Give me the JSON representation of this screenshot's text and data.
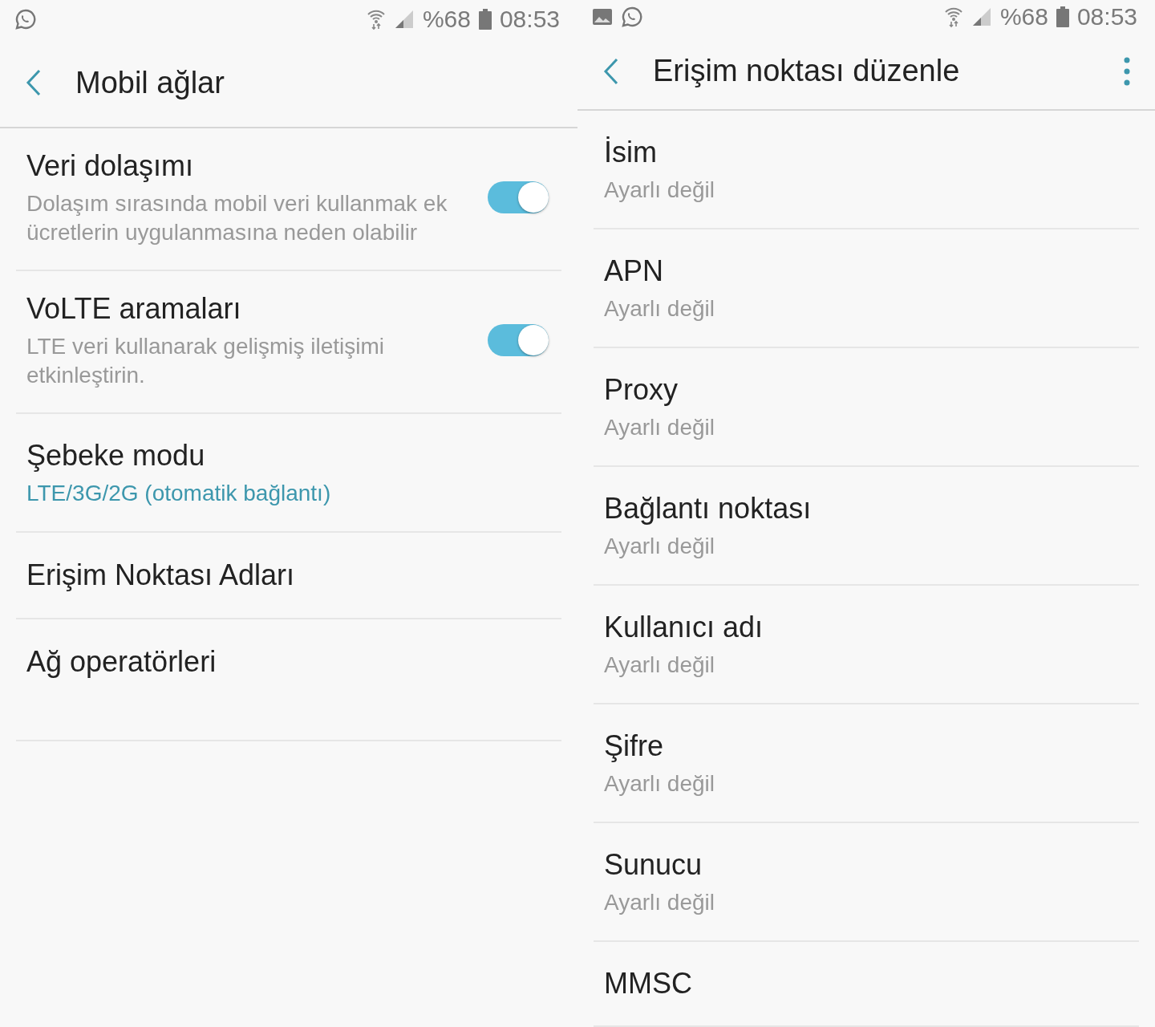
{
  "screens": [
    {
      "status_bar": {
        "notifications": [
          {
            "kind": "chat"
          }
        ],
        "battery": "%68",
        "time": "08:53"
      },
      "title": "Mobil ağlar",
      "has_menu": false,
      "items": [
        {
          "kind": "toggle",
          "title": "Veri dolaşımı",
          "summary": "Dolaşım sırasında mobil veri kullanmak ek ücretlerin uygulanmasına neden olabilir",
          "on": true
        },
        {
          "kind": "toggle",
          "title": "VoLTE aramaları",
          "summary": "LTE veri kullanarak gelişmiş iletişimi etkinleştirin.",
          "on": true
        },
        {
          "kind": "choice",
          "title": "Şebeke modu",
          "summary": "LTE/3G/2G (otomatik bağlantı)"
        },
        {
          "kind": "link",
          "title": "Erişim Noktası Adları"
        },
        {
          "kind": "link",
          "title": "Ağ operatörleri"
        }
      ]
    },
    {
      "status_bar": {
        "notifications": [
          {
            "kind": "image"
          },
          {
            "kind": "chat"
          }
        ],
        "battery": "%68",
        "time": "08:53"
      },
      "title": "Erişim noktası düzenle",
      "has_menu": true,
      "items": [
        {
          "kind": "field",
          "title": "İsim",
          "summary": "Ayarlı değil"
        },
        {
          "kind": "field",
          "title": "APN",
          "summary": "Ayarlı değil"
        },
        {
          "kind": "field",
          "title": "Proxy",
          "summary": "Ayarlı değil"
        },
        {
          "kind": "field",
          "title": "Bağlantı noktası",
          "summary": "Ayarlı değil"
        },
        {
          "kind": "field",
          "title": "Kullanıcı adı",
          "summary": "Ayarlı değil"
        },
        {
          "kind": "field",
          "title": "Şifre",
          "summary": "Ayarlı değil"
        },
        {
          "kind": "field",
          "title": "Sunucu",
          "summary": "Ayarlı değil"
        },
        {
          "kind": "field",
          "title": "MMSC"
        }
      ]
    }
  ]
}
